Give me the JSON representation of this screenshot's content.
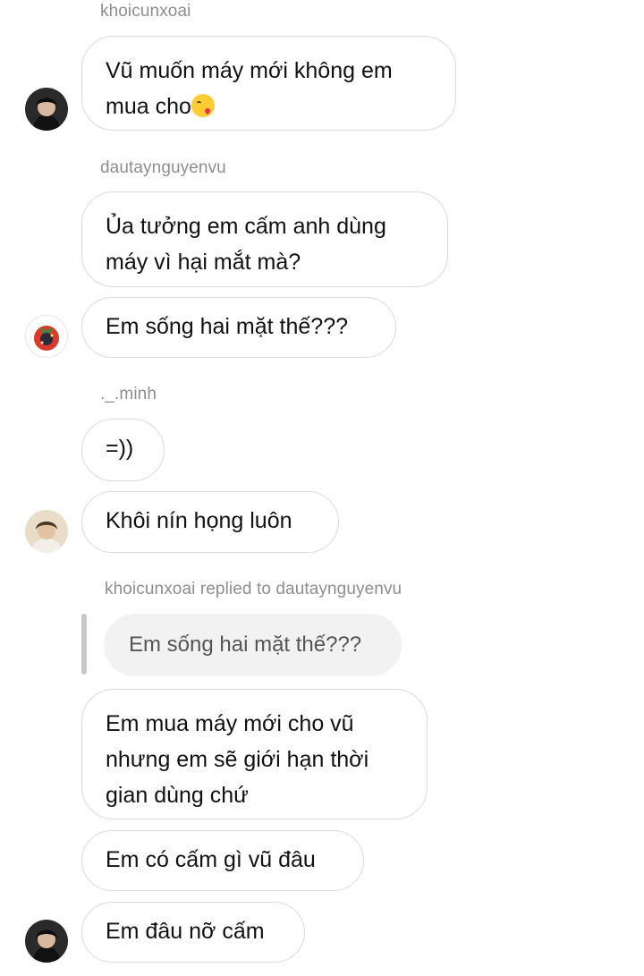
{
  "messages": {
    "m1_sender": "khoicunxoai",
    "m1_line1": "Vũ muốn máy mới không em",
    "m1_line2": "mua cho",
    "m1_emoji": "face-blowing-a-kiss-icon",
    "m2_sender": "dautaynguyenvu",
    "m2_line1": "Ủa tưởng em cấm anh dùng",
    "m2_line2": "máy vì hại mắt mà?",
    "m3_text": "Em sống hai mặt thế???",
    "m4_sender": "._.minh",
    "m4_text": "=))",
    "m5_text": "Khôi nín họng luôn",
    "m6_reply_header": "khoicunxoai replied to dautaynguyenvu",
    "m6_quoted": "Em sống hai mặt thế???",
    "m7_line1": "Em mua máy mới cho vũ",
    "m7_line2": "nhưng em sẽ giới hạn thời",
    "m7_line3": "gian dùng chứ",
    "m8_text": "Em có cấm gì vũ đâu",
    "m9_text": "Em đâu nỡ cấm"
  },
  "colors": {
    "bubble_border": "#dbdbdb",
    "sender_text": "#8e8e8e",
    "quote_bg": "#f2f2f2",
    "quote_bar": "#c7c7c7"
  }
}
